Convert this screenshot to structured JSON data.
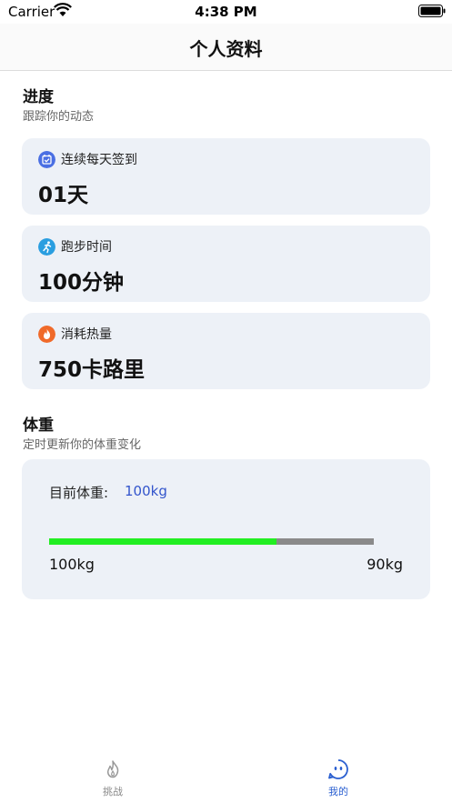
{
  "status": {
    "carrier": "Carrier",
    "time": "4:38 PM"
  },
  "nav": {
    "title": "个人资料"
  },
  "progress": {
    "title": "进度",
    "subtitle": "跟踪你的动态",
    "cards": [
      {
        "icon": "calendar-icon",
        "color": "#4a6fe3",
        "label": "连续每天签到",
        "value": "01天"
      },
      {
        "icon": "running-icon",
        "color": "#2a9ee0",
        "label": "跑步时间",
        "value": "100分钟"
      },
      {
        "icon": "flame-icon",
        "color": "#f06a2a",
        "label": "消耗热量",
        "value": "750卡路里"
      }
    ]
  },
  "weight": {
    "title": "体重",
    "subtitle": "定时更新你的体重变化",
    "current_label": "目前体重:",
    "current_value": "100kg",
    "range_start": "100kg",
    "range_end": "90kg",
    "progress_fraction": 0.7,
    "fill_color": "#22ee22",
    "track_color": "#8a8a8a"
  },
  "tabs": [
    {
      "label": "挑战",
      "icon": "flame-outline-icon",
      "active": false
    },
    {
      "label": "我的",
      "icon": "face-icon",
      "active": true
    }
  ],
  "colors": {
    "accent": "#2a5fd0",
    "card_bg": "#edf1f7"
  }
}
